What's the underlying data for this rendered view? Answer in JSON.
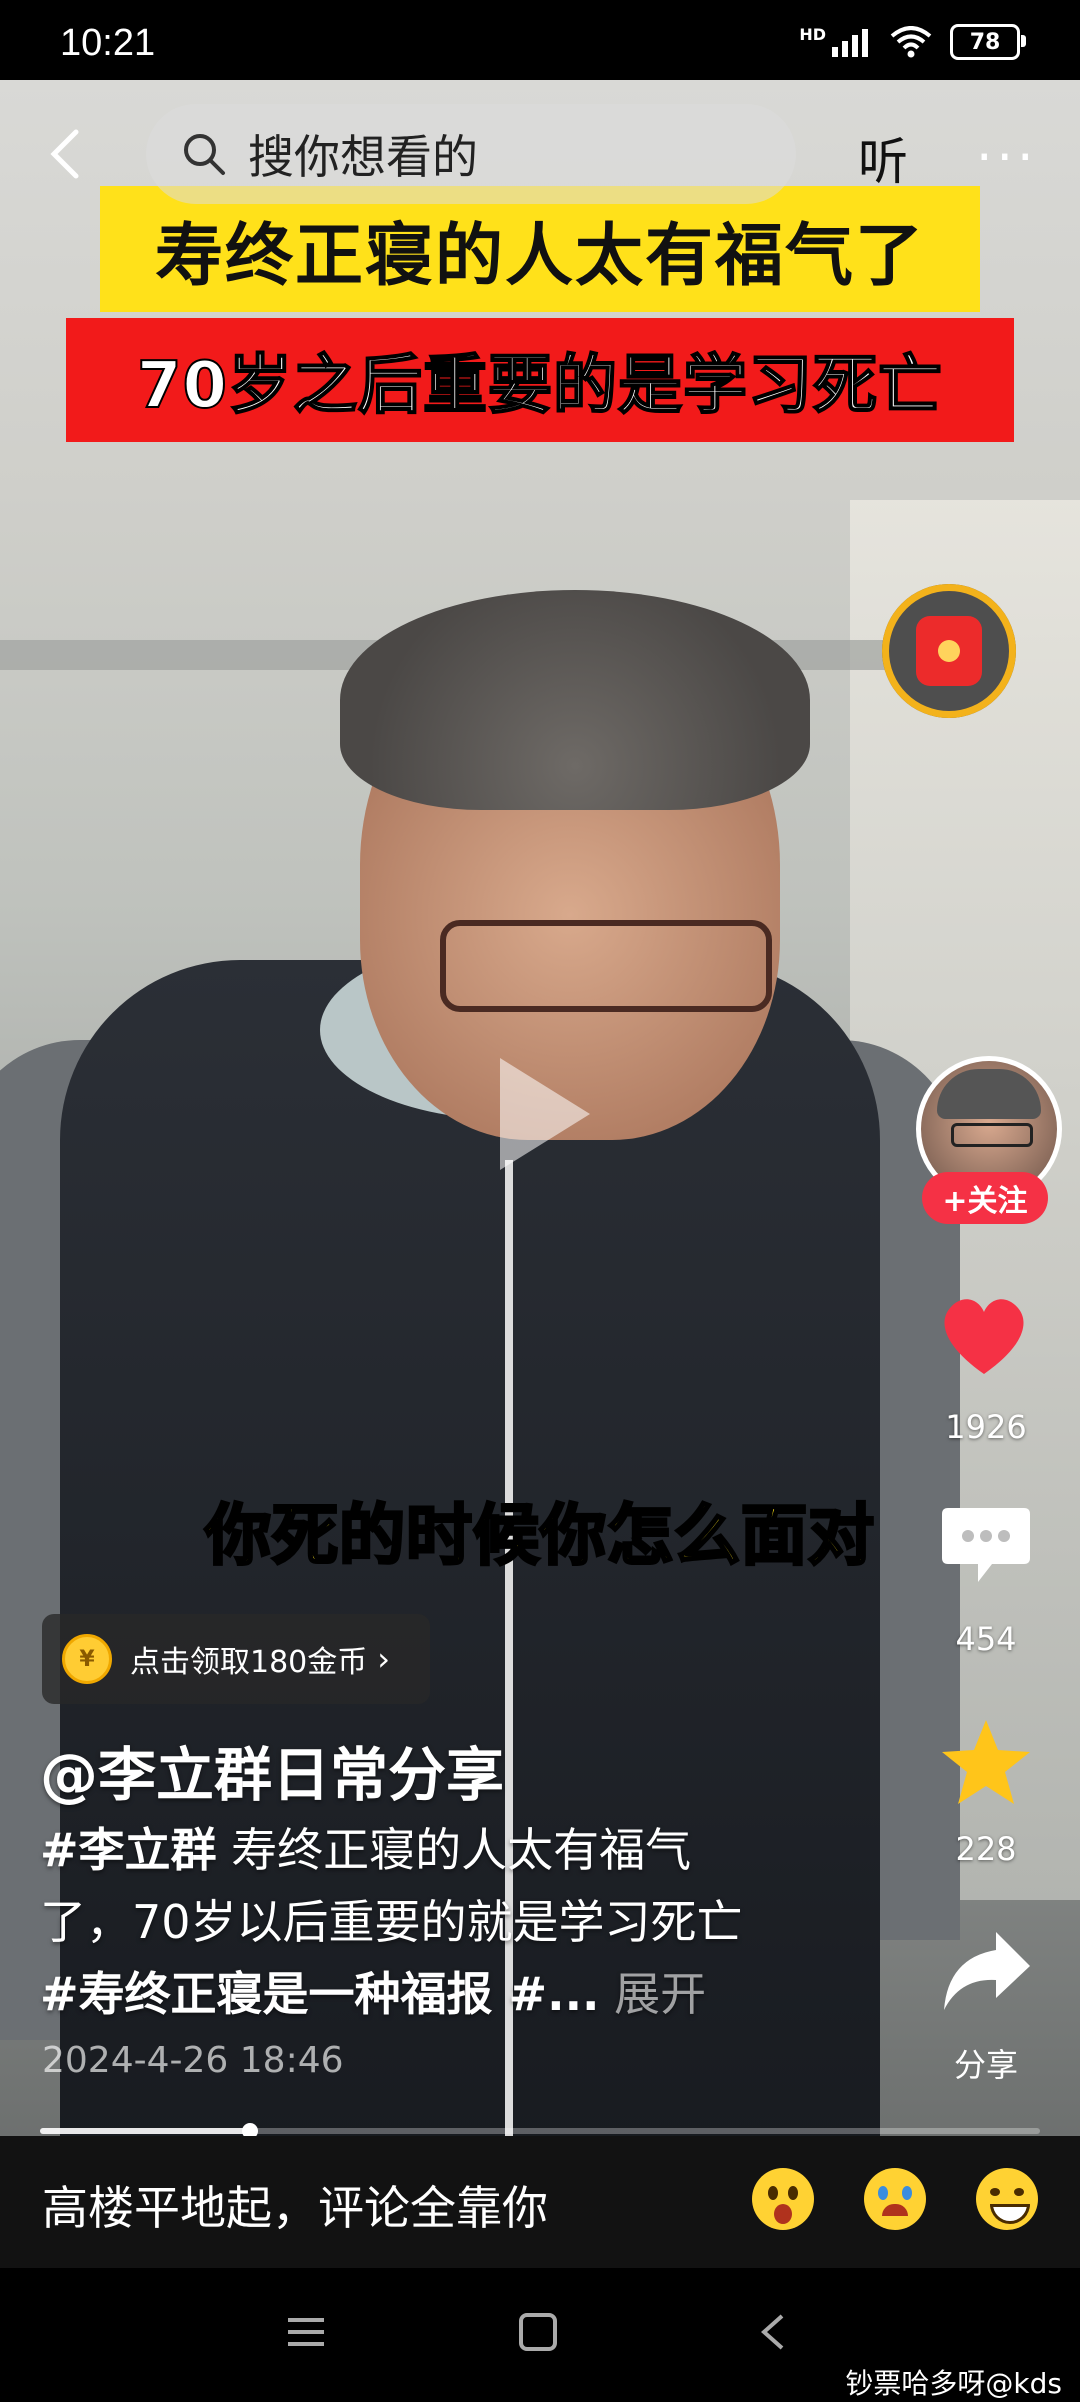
{
  "status_bar": {
    "time": "10:21",
    "network": "HD",
    "battery": "78"
  },
  "top_bar": {
    "search_placeholder": "搜你想看的",
    "listen_label": "听",
    "more_label": "···"
  },
  "video": {
    "title_banner": "寿终正寝的人太有福气了",
    "subtitle_banner": "70岁之后重要的是学习死亡",
    "caption": "你死的时候你怎么面对"
  },
  "side_rail": {
    "follow_label": "+关注",
    "likes": "1926",
    "comments": "454",
    "favorites": "228",
    "share_label": "分享"
  },
  "coin_pill": {
    "text": "点击领取180金币",
    "arrow": "›"
  },
  "post": {
    "author": "@李立群日常分享",
    "desc_tag1": "#李立群",
    "desc_line1_rest": " 寿终正寝的人太有福气",
    "desc_line2": "了，70岁以后重要的就是学习死亡",
    "desc_tag2": "#寿终正寝是一种福报 #...",
    "desc_expand": " 展开",
    "date": "2024-4-26 18:46",
    "progress": 0.21
  },
  "comment_bar": {
    "placeholder": "高楼平地起，评论全靠你"
  },
  "emoji_icons": [
    "surprised-emoji",
    "crying-emoji",
    "grin-emoji"
  ],
  "watermark": "钞票哈多呀@kds",
  "colors": {
    "like": "#f53145",
    "title_bg": "#ffe11a",
    "subtitle_bg": "#f21a1a",
    "caption": "#ffe41a",
    "star": "#ffc51a"
  }
}
